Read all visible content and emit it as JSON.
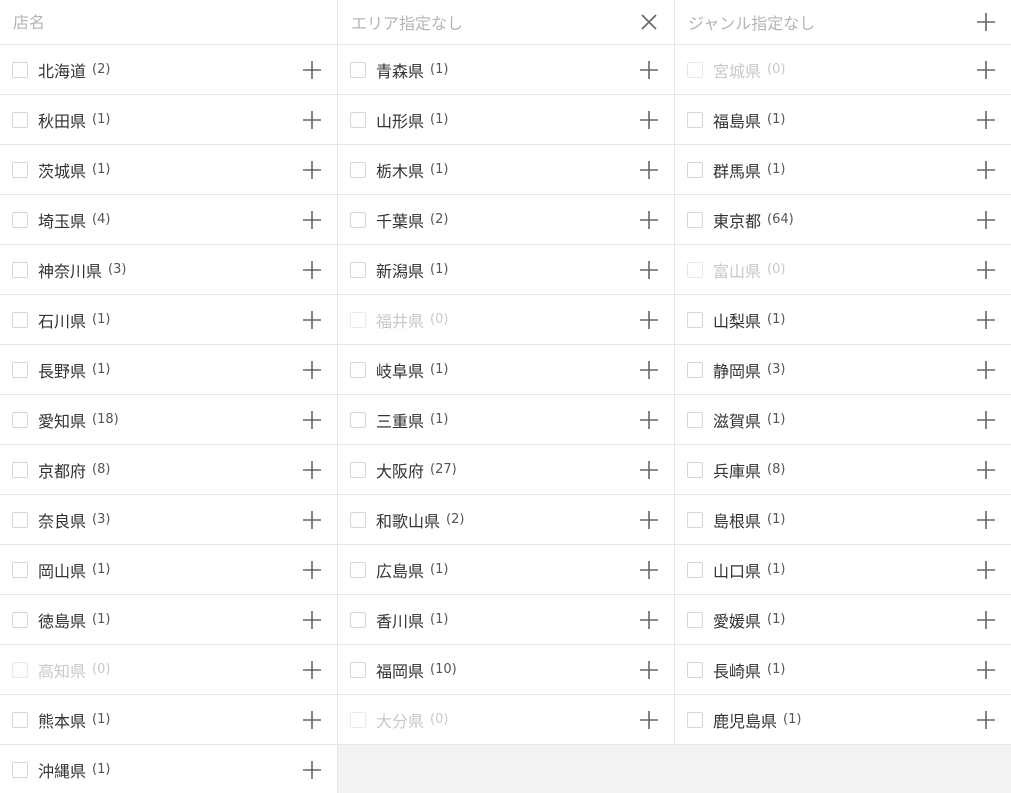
{
  "header": {
    "store_name_placeholder": "店名",
    "area_label": "エリア指定なし",
    "genre_label": "ジャンル指定なし"
  },
  "prefectures": [
    {
      "name": "北海道",
      "count": "(2)",
      "disabled": false
    },
    {
      "name": "青森県",
      "count": "(1)",
      "disabled": false
    },
    {
      "name": "宮城県",
      "count": "(0)",
      "disabled": true
    },
    {
      "name": "秋田県",
      "count": "(1)",
      "disabled": false
    },
    {
      "name": "山形県",
      "count": "(1)",
      "disabled": false
    },
    {
      "name": "福島県",
      "count": "(1)",
      "disabled": false
    },
    {
      "name": "茨城県",
      "count": "(1)",
      "disabled": false
    },
    {
      "name": "栃木県",
      "count": "(1)",
      "disabled": false
    },
    {
      "name": "群馬県",
      "count": "(1)",
      "disabled": false
    },
    {
      "name": "埼玉県",
      "count": "(4)",
      "disabled": false
    },
    {
      "name": "千葉県",
      "count": "(2)",
      "disabled": false
    },
    {
      "name": "東京都",
      "count": "(64)",
      "disabled": false
    },
    {
      "name": "神奈川県",
      "count": "(3)",
      "disabled": false
    },
    {
      "name": "新潟県",
      "count": "(1)",
      "disabled": false
    },
    {
      "name": "富山県",
      "count": "(0)",
      "disabled": true
    },
    {
      "name": "石川県",
      "count": "(1)",
      "disabled": false
    },
    {
      "name": "福井県",
      "count": "(0)",
      "disabled": true
    },
    {
      "name": "山梨県",
      "count": "(1)",
      "disabled": false
    },
    {
      "name": "長野県",
      "count": "(1)",
      "disabled": false
    },
    {
      "name": "岐阜県",
      "count": "(1)",
      "disabled": false
    },
    {
      "name": "静岡県",
      "count": "(3)",
      "disabled": false
    },
    {
      "name": "愛知県",
      "count": "(18)",
      "disabled": false
    },
    {
      "name": "三重県",
      "count": "(1)",
      "disabled": false
    },
    {
      "name": "滋賀県",
      "count": "(1)",
      "disabled": false
    },
    {
      "name": "京都府",
      "count": "(8)",
      "disabled": false
    },
    {
      "name": "大阪府",
      "count": "(27)",
      "disabled": false
    },
    {
      "name": "兵庫県",
      "count": "(8)",
      "disabled": false
    },
    {
      "name": "奈良県",
      "count": "(3)",
      "disabled": false
    },
    {
      "name": "和歌山県",
      "count": "(2)",
      "disabled": false
    },
    {
      "name": "島根県",
      "count": "(1)",
      "disabled": false
    },
    {
      "name": "岡山県",
      "count": "(1)",
      "disabled": false
    },
    {
      "name": "広島県",
      "count": "(1)",
      "disabled": false
    },
    {
      "name": "山口県",
      "count": "(1)",
      "disabled": false
    },
    {
      "name": "徳島県",
      "count": "(1)",
      "disabled": false
    },
    {
      "name": "香川県",
      "count": "(1)",
      "disabled": false
    },
    {
      "name": "愛媛県",
      "count": "(1)",
      "disabled": false
    },
    {
      "name": "高知県",
      "count": "(0)",
      "disabled": true
    },
    {
      "name": "福岡県",
      "count": "(10)",
      "disabled": false
    },
    {
      "name": "長崎県",
      "count": "(1)",
      "disabled": false
    },
    {
      "name": "熊本県",
      "count": "(1)",
      "disabled": false
    },
    {
      "name": "大分県",
      "count": "(0)",
      "disabled": true
    },
    {
      "name": "鹿児島県",
      "count": "(1)",
      "disabled": false
    },
    {
      "name": "沖縄県",
      "count": "(1)",
      "disabled": false
    }
  ],
  "icons": {
    "clear": "close-icon",
    "expand": "plus-icon"
  },
  "colors": {
    "text": "#333333",
    "disabled_text": "#c8c8c8",
    "placeholder": "#b5b5b5",
    "border": "#e6e6e6",
    "icon": "#666666"
  }
}
